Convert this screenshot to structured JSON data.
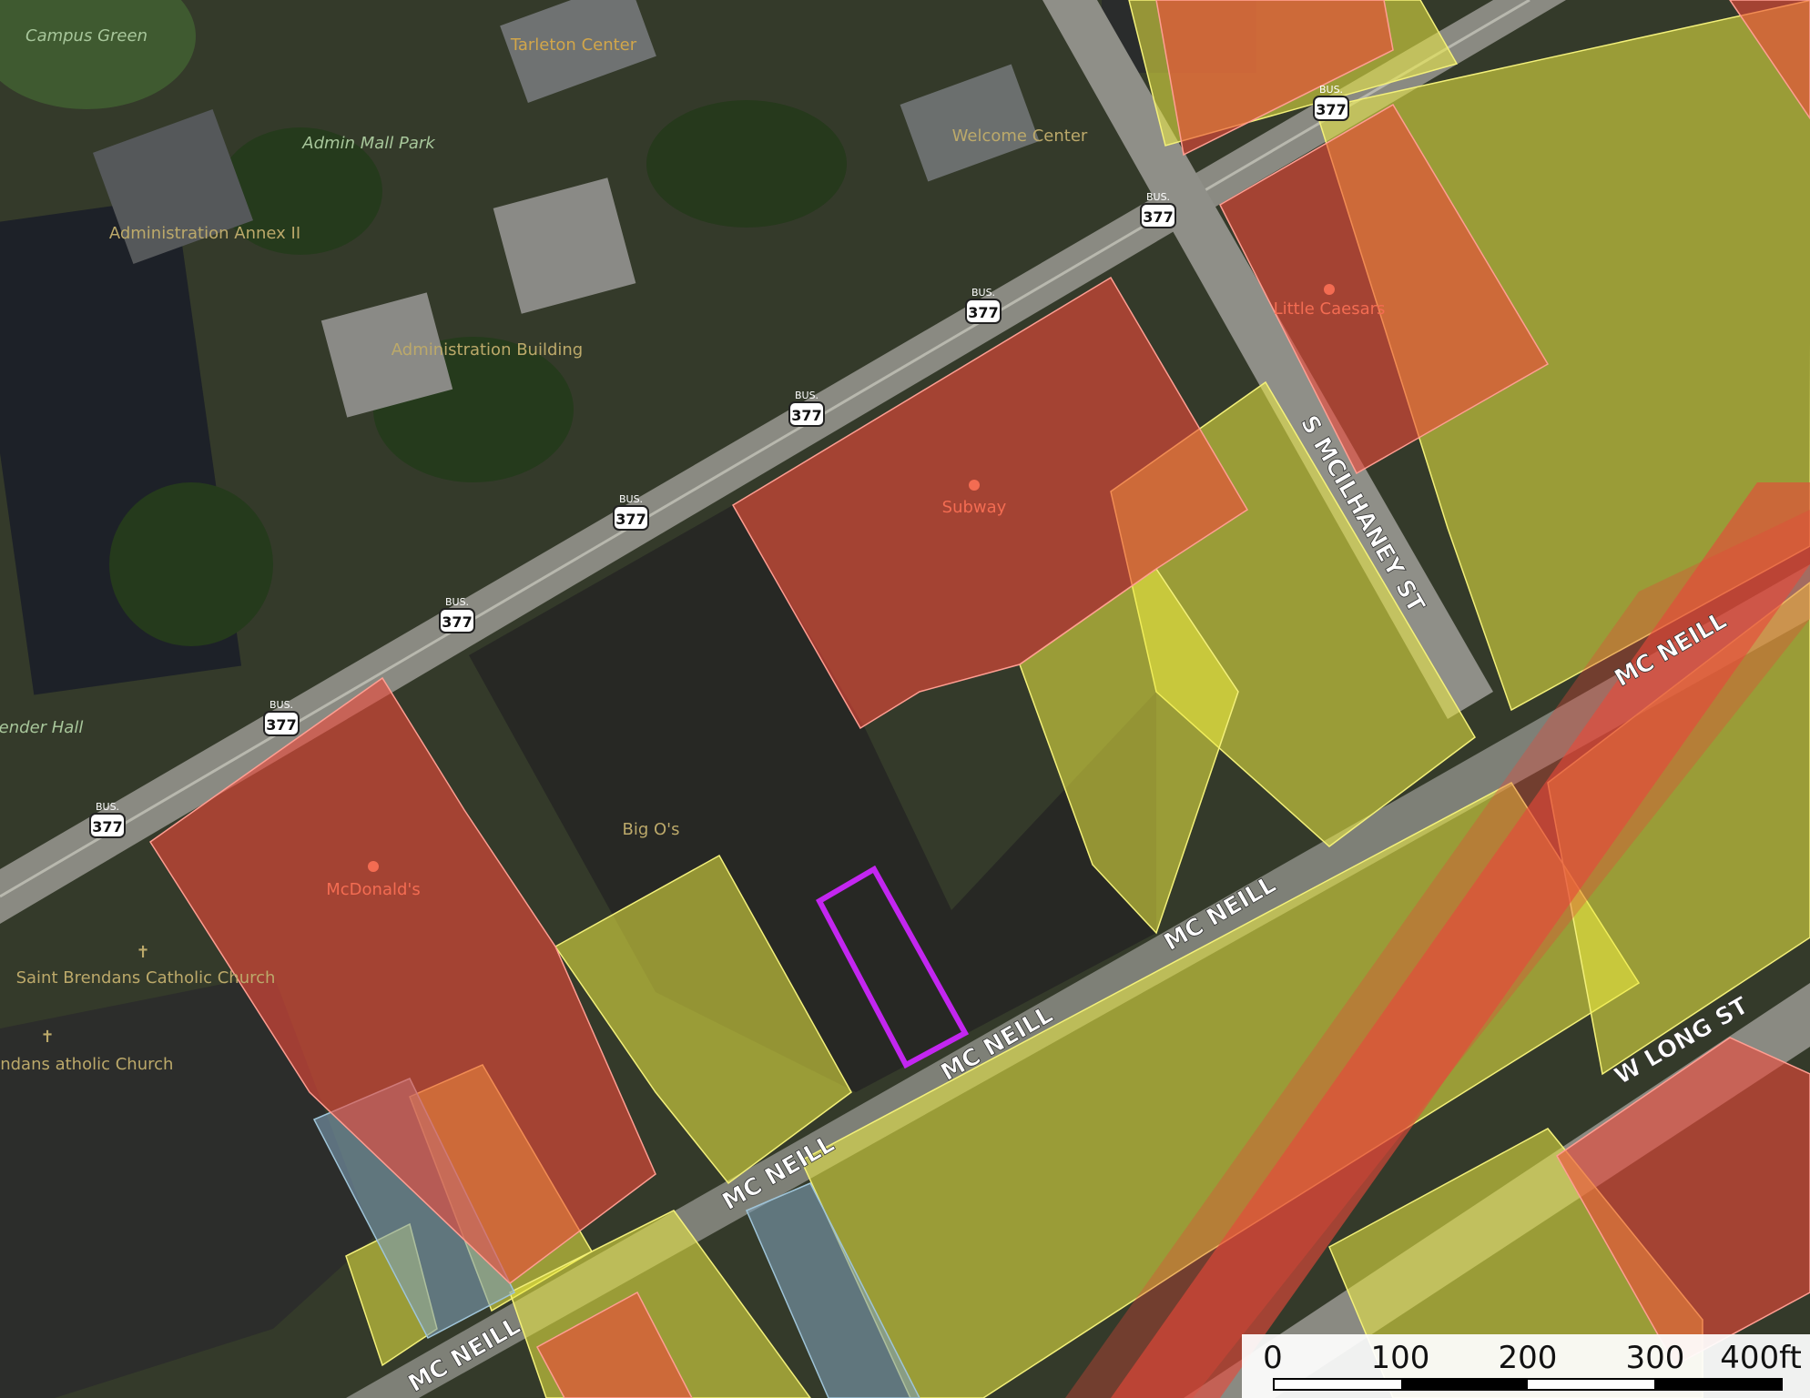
{
  "map": {
    "poi_labels": [
      "Campus Green",
      "Tarleton Center",
      "Admin Mall Park",
      "Administration Annex II",
      "Welcome Center",
      "Administration Building",
      "Little Caesars",
      "Subway",
      "McDonald's",
      "Big O's",
      "Saint Brendans Catholic Church",
      "aint Brendans atholic Church",
      "ender Hall"
    ],
    "street_labels": {
      "mcilhaney": "S MCILHANEY ST",
      "mcneill": "MC NEILL",
      "wlong": "W LONG ST"
    },
    "route_shield": {
      "top": "BUS.",
      "number": "377"
    },
    "zoning_colors": {
      "commercial": "#f0493a",
      "residential": "#eeec42",
      "institutional": "#7f9fb5",
      "railroad": "#e8483a",
      "selected_parcel": "#c326f0"
    }
  },
  "scale_bar": {
    "ticks": [
      "0",
      "100",
      "200",
      "300",
      "400ft"
    ]
  }
}
